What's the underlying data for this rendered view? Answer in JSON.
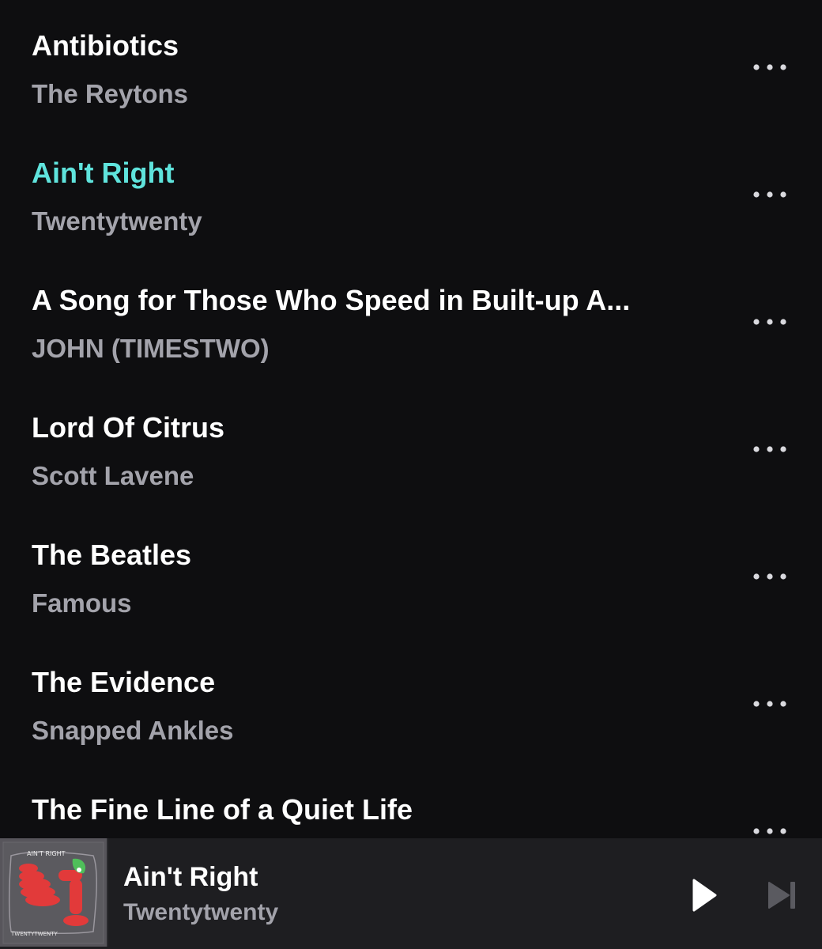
{
  "track_list": {
    "items": [
      {
        "title": "Antibiotics",
        "artist": "The Reytons",
        "active": false
      },
      {
        "title": "Ain't Right",
        "artist": "Twentytwenty",
        "active": true
      },
      {
        "title": "A Song for Those Who Speed in Built-up A...",
        "artist": "JOHN (TIMESTWO)",
        "active": false
      },
      {
        "title": "Lord Of Citrus",
        "artist": "Scott Lavene",
        "active": false
      },
      {
        "title": "The Beatles",
        "artist": "Famous",
        "active": false
      },
      {
        "title": "The Evidence",
        "artist": "Snapped Ankles",
        "active": false
      },
      {
        "title": "The Fine Line of a Quiet Life",
        "artist": "",
        "active": false
      }
    ],
    "more_icon": "more-horizontal-icon"
  },
  "mini_player": {
    "title": "Ain't Right",
    "artist": "Twentytwenty",
    "artwork": {
      "text_top": "AIN'T RIGHT",
      "text_bottom": "TWENTYTWENTY"
    },
    "play_icon": "play-icon",
    "next_icon": "skip-next-icon"
  },
  "colors": {
    "background": "#0e0e10",
    "active_title": "#5fe3dc",
    "title": "#ffffff",
    "artist": "#a3a3ab",
    "player_bg": "#1e1e21",
    "next_disabled": "#5a5a60"
  }
}
